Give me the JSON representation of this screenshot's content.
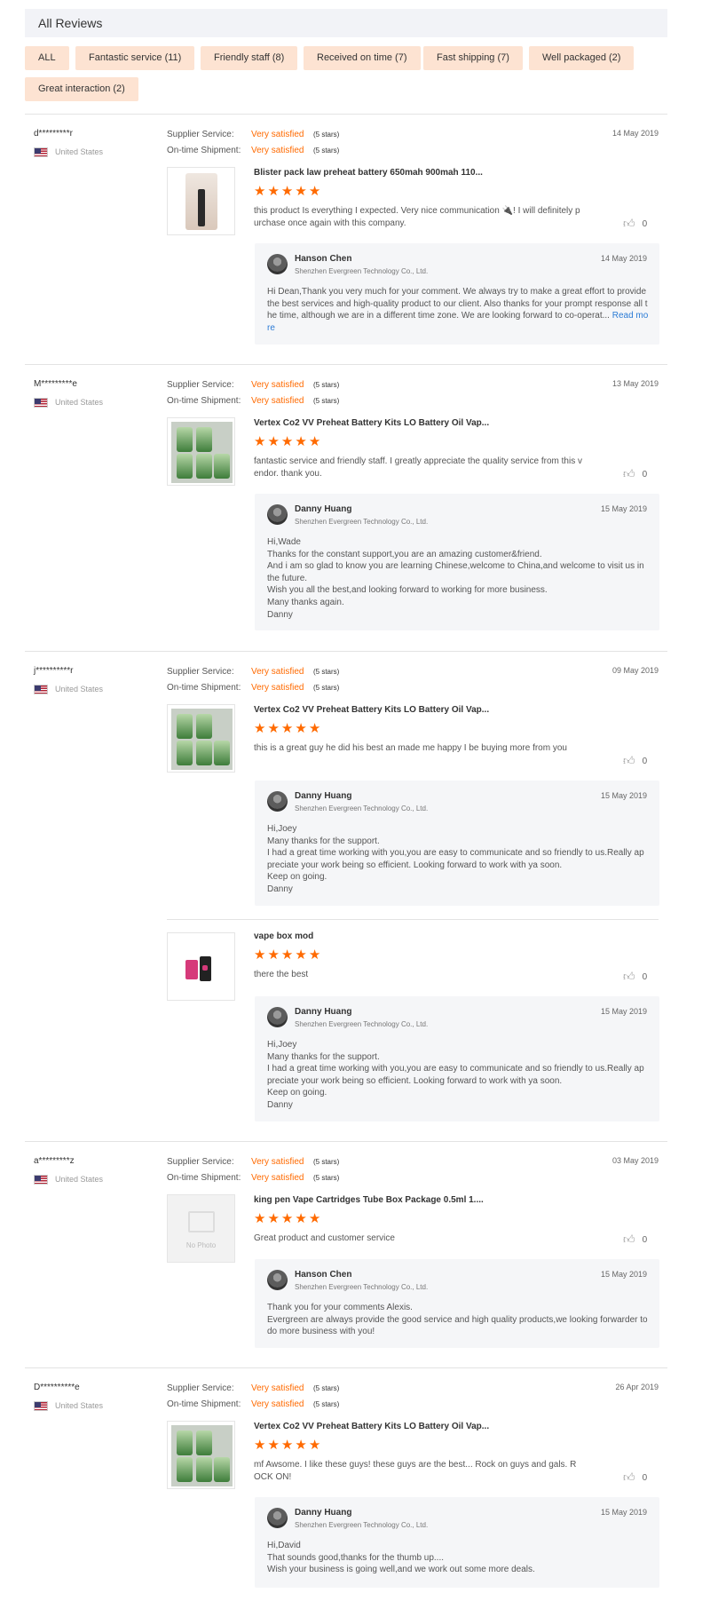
{
  "header": {
    "title": "All Reviews"
  },
  "filters": [
    "ALL",
    "Fantastic service (11)",
    "Friendly staff (8)",
    "Received on time (7)",
    "Fast shipping (7)",
    "Well packaged (2)",
    "Great interaction (2)"
  ],
  "labels": {
    "supplier_service": "Supplier Service:",
    "ontime_shipment": "On-time Shipment:",
    "very_satisfied": "Very satisfied",
    "five_stars": "(5 stars)",
    "read_more": "Read more",
    "no_photo": "No Photo",
    "star": "★",
    "like_icon": "thumbs-up-icon"
  },
  "reviews": [
    {
      "user": "d*********r",
      "country": "United States",
      "date": "14 May 2019",
      "products": [
        {
          "title": "Blister pack law preheat battery 650mah 900mah 110...",
          "text": "this product Is everything I expected. Very nice communication 🔌! I will definitely purchase once again with this company.",
          "likes": "0",
          "reply": {
            "name": "Hanson Chen",
            "company": "Shenzhen Evergreen Technology Co., Ltd.",
            "date": "14 May 2019",
            "text": "Hi Dean,Thank you very much for your comment. We always try to make a great effort to provide the best services and high-quality product to our client. Also thanks for your prompt response all the time, although we are in a different time zone. We are looking forward to co-operat..."
          }
        }
      ]
    },
    {
      "user": "M*********e",
      "country": "United States",
      "date": "13 May 2019",
      "products": [
        {
          "title": "Vertex Co2 VV Preheat Battery Kits LO Battery Oil Vap...",
          "text": "fantastic service and friendly staff.  I greatly appreciate the quality service from this vendor.  thank you.",
          "likes": "0",
          "reply": {
            "name": "Danny Huang",
            "company": "Shenzhen Evergreen Technology Co., Ltd.",
            "date": "15 May 2019",
            "text": "Hi,Wade\nThanks for the constant support,you are an amazing customer&friend.\nAnd i am so glad to know you are learning Chinese,welcome to China,and welcome to visit us in the future.\nWish you all the best,and looking forward to working for more business.\nMany thanks again.\nDanny"
          }
        }
      ]
    },
    {
      "user": "j**********r",
      "country": "United States",
      "date": "09 May 2019",
      "products": [
        {
          "title": "Vertex Co2 VV Preheat Battery Kits LO Battery Oil Vap...",
          "text": "this is a great guy he did his best an made me happy I be buying more from you",
          "likes": "0",
          "reply": {
            "name": "Danny Huang",
            "company": "Shenzhen Evergreen Technology Co., Ltd.",
            "date": "15 May 2019",
            "text": "Hi,Joey\nMany thanks for the support.\nI had a great time working with you,you are easy to communicate and so friendly to us.Really appreciate your work being so efficient. Looking forward to work with ya soon.\nKeep on going.\nDanny"
          }
        },
        {
          "title": "vape box mod",
          "text": "there the best",
          "likes": "0",
          "reply": {
            "name": "Danny Huang",
            "company": "Shenzhen Evergreen Technology Co., Ltd.",
            "date": "15 May 2019",
            "text": "Hi,Joey\nMany thanks for the support.\nI had a great time working with you,you are easy to communicate and so friendly to us.Really appreciate your work being so efficient. Looking forward to work with ya soon.\nKeep on going.\nDanny"
          }
        }
      ]
    },
    {
      "user": "a*********z",
      "country": "United States",
      "date": "03 May 2019",
      "products": [
        {
          "title": "king pen Vape Cartridges Tube Box Package 0.5ml 1....",
          "text": "Great product and customer service",
          "likes": "0",
          "reply": {
            "name": "Hanson Chen",
            "company": "Shenzhen Evergreen Technology Co., Ltd.",
            "date": "15 May 2019",
            "text": "Thank you for your comments Alexis.\nEvergreen are always provide the good service and high quality products,we looking forwarder to do more business with you!"
          }
        }
      ]
    },
    {
      "user": "D**********e",
      "country": "United States",
      "date": "26 Apr 2019",
      "products": [
        {
          "title": "Vertex Co2 VV Preheat Battery Kits LO Battery Oil Vap...",
          "text": "mf Awsome.  I like these guys!  these guys are the best...  Rock on guys and gals.  ROCK ON!",
          "likes": "0",
          "reply": {
            "name": "Danny Huang",
            "company": "Shenzhen Evergreen Technology Co., Ltd.",
            "date": "15 May 2019",
            "text": "Hi,David\nThat sounds good,thanks for the thumb up....\nWish your business is going well,and we work out some more deals."
          }
        }
      ]
    }
  ]
}
